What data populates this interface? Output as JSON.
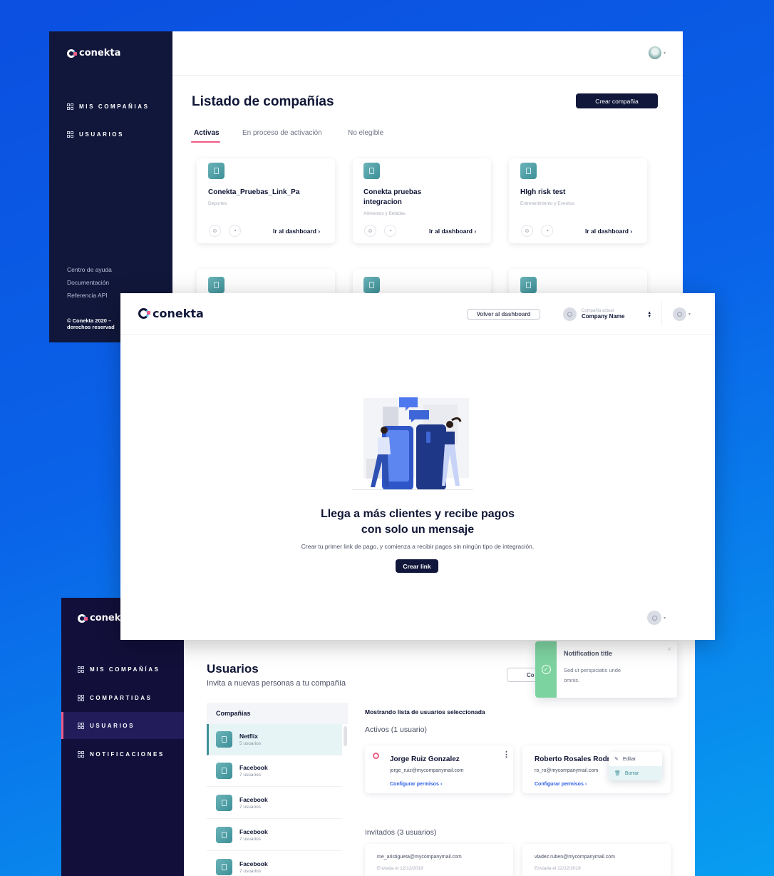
{
  "brand": {
    "logo_text": "conekta"
  },
  "screen1": {
    "sidebar": {
      "items": [
        {
          "label": "MIS COMPAÑIAS",
          "icon": "grid-icon"
        },
        {
          "label": "USUARIOS",
          "icon": "grid-icon"
        }
      ],
      "footer_links": [
        "Centro de ayuda",
        "Documentación",
        "Referencia API"
      ],
      "copyright": "© Conekta 2020 –",
      "copyright_line2": "derechos reservad"
    },
    "page_title": "Listado de compañías",
    "create_button": "Crear compañia",
    "tabs": [
      {
        "label": "Activas",
        "active": true
      },
      {
        "label": "En proceso de activación",
        "active": false
      },
      {
        "label": "No elegible",
        "active": false
      }
    ],
    "cards": [
      {
        "title": "Conekta_Pruebas_Link_Pa",
        "title2": "",
        "category": "Deportes",
        "link": "Ir al dashboard"
      },
      {
        "title": "Conekta pruebas",
        "title2": "integracion",
        "category": "Alimentos y Bebidas",
        "link": "Ir al dashboard"
      },
      {
        "title": "HIgh risk test",
        "title2": "",
        "category": "Entretenimiento y Eventos",
        "link": "Ir al dashboard"
      }
    ]
  },
  "screen2": {
    "back_button": "Volver al dashboard",
    "company_label": "Compañia actual",
    "company_name": "Company Name",
    "empty_title_line1": "Llega a más clientes y recibe pagos",
    "empty_title_line2": "con solo un mensaje",
    "empty_desc": "Crear tu primer link de pago, y comienza a recibir pagos sin ningún tipo de integración.",
    "create_link_button": "Crear link"
  },
  "screen3": {
    "sidebar": {
      "items": [
        {
          "label": "MIS COMPAÑÍAS",
          "active": false
        },
        {
          "label": "COMPARTIDAS",
          "active": false
        },
        {
          "label": "USUARIOS",
          "active": true
        },
        {
          "label": "NOTIFICACIONES",
          "active": false
        }
      ]
    },
    "page_title": "Usuarios",
    "page_subtitle": "Invita a nuevas personas a tu compañía",
    "partial_button": "Co",
    "companies_header": "Compañías",
    "companies": [
      {
        "name": "Netflix",
        "users": "5 usuarios",
        "active": true
      },
      {
        "name": "Facebook",
        "users": "7 usuarios",
        "active": false
      },
      {
        "name": "Facebook",
        "users": "7 usuarios",
        "active": false
      },
      {
        "name": "Facebook",
        "users": "7 usuarios",
        "active": false
      },
      {
        "name": "Facebook",
        "users": "7 usuarios",
        "active": false
      }
    ],
    "list_header": "Mostrando lista de usuarios seleccionada",
    "active_section": "Activos (1 usuario)",
    "users": [
      {
        "name": "Jorge Ruiz Gonzalez",
        "email": "jorge_ruiz@mycompanymail.com",
        "permissions": "Configurar permisos"
      },
      {
        "name": "Roberto Rosales Rodr",
        "email": "ro_ro@mycompanymail.com",
        "permissions": "Configurar permisos"
      }
    ],
    "menu": {
      "edit": "Editar",
      "delete": "Borrar"
    },
    "invited_section": "Invitados (3 usuarios)",
    "invited": [
      {
        "email": "me_aristigueta@mycompanymail.com",
        "sent": "Enviada el 12/12/2019"
      },
      {
        "email": "vladez.ruben@mycompanymail.com",
        "sent": "Enviada el 12/12/2019"
      }
    ],
    "notification": {
      "title": "Notification title",
      "body_line1": "Sed ut perspiciatis unde",
      "body_line2": "omnis."
    }
  },
  "colors": {
    "sidebar_dark": "#10173a",
    "sidebar_purple": "#120f3a",
    "accent_pink": "#ef5b86",
    "teal": "#3d8f97",
    "link_blue": "#2b5ce6",
    "success_green": "#7dd3a0"
  }
}
